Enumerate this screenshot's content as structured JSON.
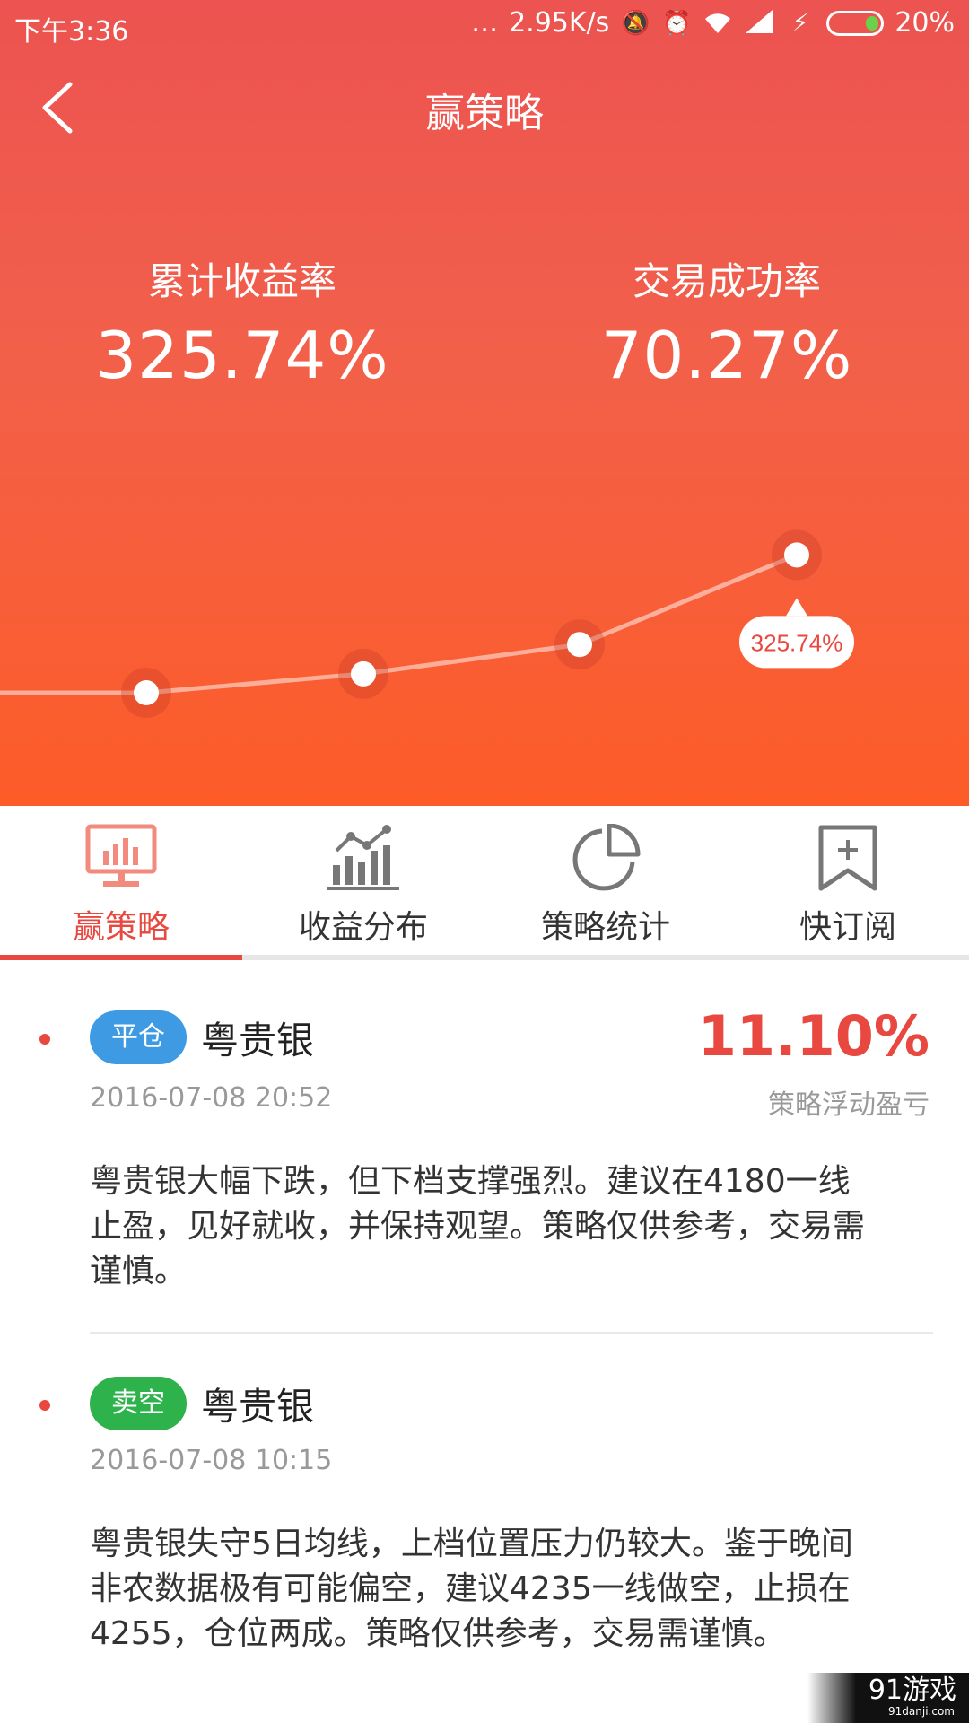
{
  "status_bar": {
    "time": "下午3:36",
    "dots": "…",
    "speed": "2.95K/s",
    "battery": "20%",
    "icons": [
      "mute-icon",
      "alarm-icon",
      "wifi-icon",
      "signal-icon",
      "charging-icon",
      "battery-icon"
    ]
  },
  "header": {
    "title": "赢策略"
  },
  "stats": {
    "cumulative_return_label": "累计收益率",
    "cumulative_return_value": "325.74%",
    "success_rate_label": "交易成功率",
    "success_rate_value": "70.27%"
  },
  "chart_data": {
    "type": "line",
    "callout_label": "325.74%",
    "points_relative": [
      0.0,
      0.11,
      0.28,
      0.8
    ],
    "color_line": "#ffffff",
    "grid": false
  },
  "tabs": [
    {
      "label": "赢策略",
      "icon": "monitor-chart-icon",
      "active": true
    },
    {
      "label": "收益分布",
      "icon": "bar-line-chart-icon",
      "active": false
    },
    {
      "label": "策略统计",
      "icon": "pie-chart-icon",
      "active": false
    },
    {
      "label": "快订阅",
      "icon": "bookmark-add-icon",
      "active": false
    }
  ],
  "items": [
    {
      "badge": "平仓",
      "badge_color": "#3f9ae4",
      "name": "粤贵银",
      "time": "2016-07-08 20:52",
      "pnl": "11.10%",
      "pnl_label": "策略浮动盈亏",
      "desc_lines": [
        "粤贵银大幅下跌，但下档支撑强烈。建议在4180一线",
        "止盈，见好就收，并保持观望。策略仅供参考，交易需",
        "谨慎。"
      ]
    },
    {
      "badge": "卖空",
      "badge_color": "#2eb34c",
      "name": "粤贵银",
      "time": "2016-07-08 10:15",
      "desc_lines": [
        "粤贵银失守5日均线，上档位置压力仍较大。鉴于晚间",
        "非农数据极有可能偏空，建议4235一线做空，止损在",
        "4255，仓位两成。策略仅供参考，交易需谨慎。"
      ]
    }
  ],
  "watermark": {
    "brand": "91游戏",
    "site": "91danji.com"
  },
  "colors": {
    "accent": "#e8483f",
    "hero_top": "#ec5351",
    "hero_bottom": "#fd5c28"
  }
}
